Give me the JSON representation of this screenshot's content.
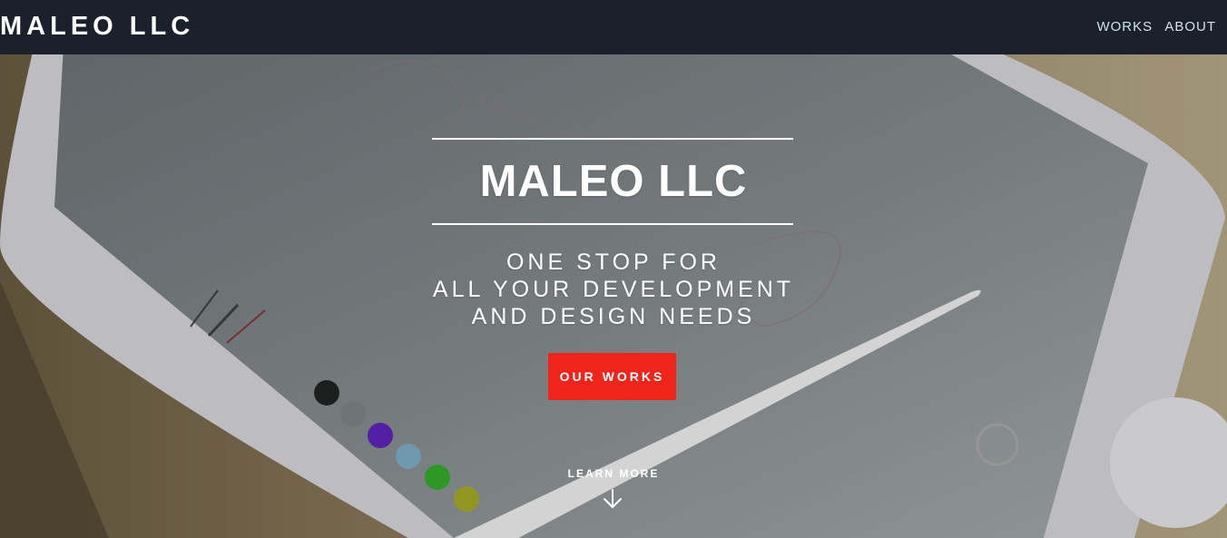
{
  "nav": {
    "brand": "MALEO LLC",
    "links": [
      "WORKS",
      "ABOUT"
    ]
  },
  "hero": {
    "title": "MALEO LLC",
    "tagline": [
      "ONE STOP FOR",
      "ALL YOUR DEVELOPMENT",
      "AND DESIGN NEEDS"
    ],
    "cta_label": "OUR WORKS",
    "learn_more_label": "LEARN MORE"
  },
  "colors": {
    "navbar_bg": "#1b212b",
    "cta_bg": "#f1241b",
    "nav_link": "#cfe3ea"
  },
  "icons": {
    "scroll": "arrow-down-icon",
    "background": "tablet-with-stylus-photo"
  }
}
